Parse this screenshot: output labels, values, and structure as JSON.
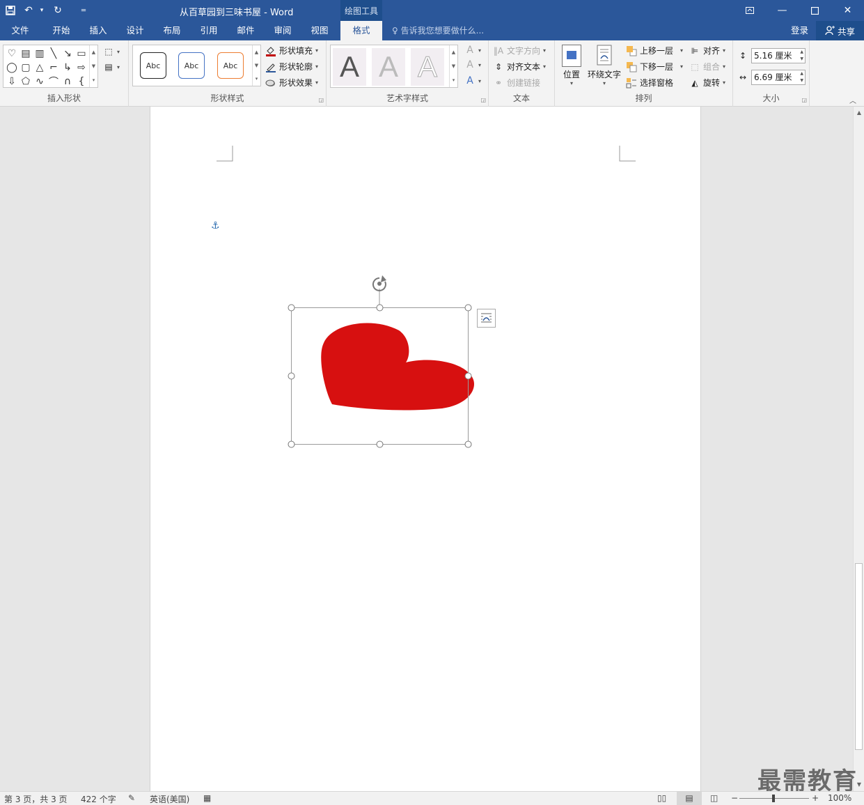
{
  "window": {
    "title": "从百草园到三味书屋 - Word",
    "context_group": "绘图工具"
  },
  "tabs": [
    "文件",
    "开始",
    "插入",
    "设计",
    "布局",
    "引用",
    "邮件",
    "审阅",
    "视图",
    "格式"
  ],
  "active_tab": "格式",
  "tell_me": "告诉我您想要做什么...",
  "account": {
    "login": "登录",
    "share": "共享"
  },
  "ribbon": {
    "insert_shapes": {
      "label": "插入形状"
    },
    "shape_styles": {
      "label": "形状样式",
      "swatches": [
        "Abc",
        "Abc",
        "Abc"
      ],
      "fill": "形状填充",
      "outline": "形状轮廓",
      "effects": "形状效果"
    },
    "wordart": {
      "label": "艺术字样式",
      "sample": "A"
    },
    "text": {
      "label": "文本",
      "direction": "文字方向",
      "align_text": "对齐文本",
      "create_link": "创建链接"
    },
    "arrange": {
      "label": "排列",
      "position": "位置",
      "wrap_text": "环绕文字",
      "bring_forward": "上移一层",
      "send_backward": "下移一层",
      "selection_pane": "选择窗格",
      "align": "对齐",
      "group": "组合",
      "rotate": "旋转"
    },
    "size": {
      "label": "大小",
      "height": "5.16 厘米",
      "width": "6.69 厘米"
    }
  },
  "status": {
    "page": "第 3 页，共 3 页",
    "words": "422 个字",
    "language": "英语(美国)",
    "zoom": "100%"
  },
  "colors": {
    "brand": "#2b579a",
    "heart": "#d71010"
  },
  "watermark": "最需教育"
}
